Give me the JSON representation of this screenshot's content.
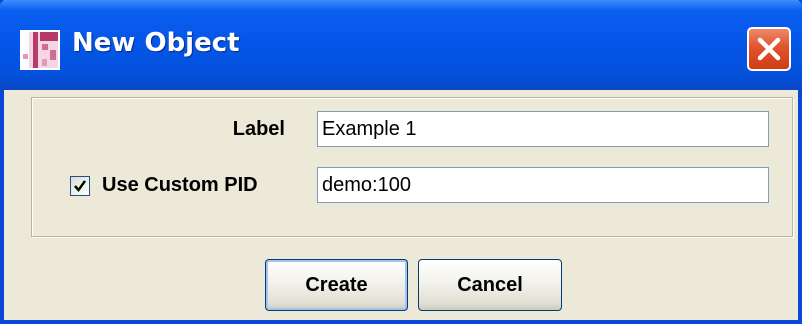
{
  "window": {
    "title": "New Object",
    "icon": "app-icon",
    "close_icon": "close-icon"
  },
  "form": {
    "label_field": {
      "label": "Label",
      "value": "Example 1"
    },
    "custom_pid": {
      "checkbox_checked": true,
      "label": "Use Custom PID",
      "value": "demo:100"
    }
  },
  "buttons": {
    "create": "Create",
    "cancel": "Cancel"
  },
  "colors": {
    "titlebar": "#0456e8",
    "window_bg": "#ece9d8",
    "close_button": "#e0542d"
  }
}
